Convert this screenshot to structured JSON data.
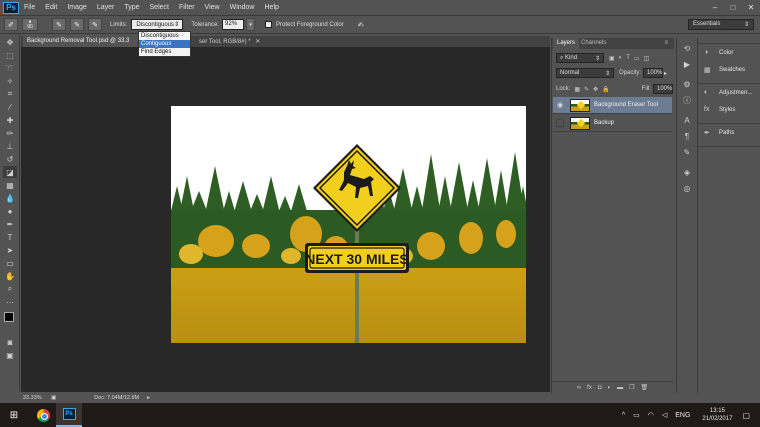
{
  "menubar": {
    "logo": "Ps",
    "items": [
      "File",
      "Edit",
      "Image",
      "Layer",
      "Type",
      "Select",
      "Filter",
      "View",
      "Window",
      "Help"
    ],
    "window_controls": [
      "–",
      "□",
      "✕"
    ]
  },
  "options_bar": {
    "brush_size": "90",
    "limits_label": "Limits:",
    "limits_value": "Discontiguous",
    "tolerance_label": "Tolerance:",
    "tolerance_value": "92%",
    "protect_label": "Protect Foreground Color",
    "workspace": "Essentials"
  },
  "limits_dropdown": {
    "options": [
      "Discontiguous",
      "Contiguous",
      "Find Edges"
    ],
    "highlighted": "Contiguous"
  },
  "document_tabs": {
    "tab1": "Background Removal Tool.psd @ 33.3",
    "tab2": "ser Tool, RGB/8#) *"
  },
  "photo": {
    "sign_text": "NEXT 30 MILES"
  },
  "status_bar": {
    "zoom": "33.33%",
    "doc": "Doc: 7.04M/12.6M"
  },
  "layers_panel": {
    "tab_layers": "Layers",
    "tab_channels": "Channels",
    "kind_label": "Kind",
    "blend_mode": "Normal",
    "opacity_label": "Opacity:",
    "opacity_value": "100%",
    "lock_label": "Lock:",
    "fill_label": "Fill:",
    "fill_value": "100%",
    "layers": [
      {
        "name": "Background Eraser Tool",
        "visible": true,
        "selected": true
      },
      {
        "name": "Backup",
        "visible": false,
        "selected": false
      }
    ]
  },
  "mini_panels": {
    "items": [
      "Color",
      "Swatches",
      "Adjustmen...",
      "Styles",
      "Paths"
    ]
  },
  "taskbar": {
    "language": "ENG",
    "time": "13:15",
    "date": "21/02/2017"
  },
  "colors": {
    "ui_bg": "#535353",
    "canvas_bg": "#282828",
    "selection_blue": "#3b73c4",
    "sign_yellow": "#f2cf1d",
    "field_gold": "#c9a21a"
  }
}
